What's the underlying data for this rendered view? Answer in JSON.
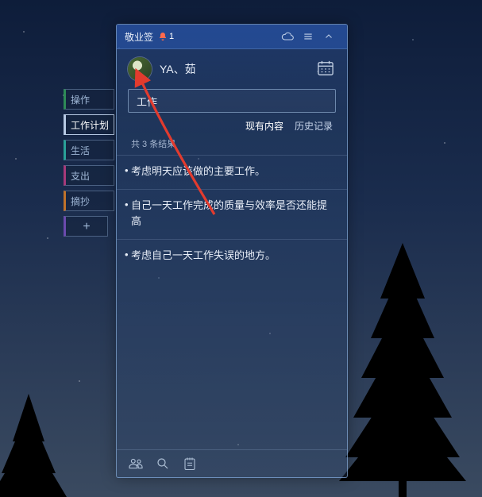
{
  "app": {
    "title": "敬业签"
  },
  "notification": {
    "count": "1"
  },
  "user": {
    "name": "YA、茹"
  },
  "search": {
    "value": "工作"
  },
  "subtabs": {
    "current": "现有内容",
    "history": "历史记录"
  },
  "results": {
    "countText": "共 3 条结果"
  },
  "notes": [
    "考虑明天应该做的主要工作。",
    "自己一天工作完成的质量与效率是否还能提高",
    "考虑自己一天工作失误的地方。"
  ],
  "sidetabs": {
    "items": [
      {
        "label": "操作"
      },
      {
        "label": "工作计划"
      },
      {
        "label": "生活"
      },
      {
        "label": "支出"
      },
      {
        "label": "摘抄"
      }
    ],
    "add": "+"
  }
}
